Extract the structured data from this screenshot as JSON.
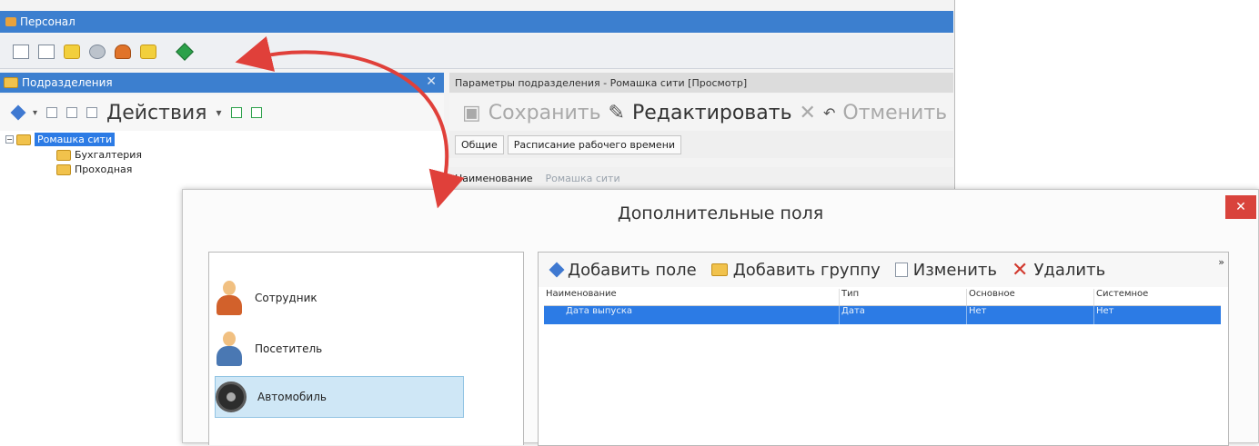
{
  "window": {
    "title": "Персонал"
  },
  "left_panel": {
    "title": "Подразделения",
    "actions_label": "Действия",
    "tree": [
      {
        "label": "Ромашка сити",
        "selected": true
      },
      {
        "label": "Бухгалтерия"
      },
      {
        "label": "Проходная"
      }
    ]
  },
  "params_panel": {
    "title": "Параметры подразделения - Ромашка сити [Просмотр]",
    "toolbar": {
      "save": "Сохранить",
      "edit": "Редактировать",
      "cancel": "Отменить"
    },
    "tabs": [
      "Общие",
      "Расписание рабочего времени"
    ],
    "name_label": "Наименование",
    "name_value": "Ромашка сити"
  },
  "dialog": {
    "title": "Дополнительные поля",
    "objects": [
      {
        "label": "Сотрудник",
        "icon": "employee-icon"
      },
      {
        "label": "Посетитель",
        "icon": "visitor-icon"
      },
      {
        "label": "Автомобиль",
        "icon": "car-wheel-icon",
        "selected": true
      }
    ],
    "toolbar": {
      "add_field": "Добавить поле",
      "add_group": "Добавить группу",
      "edit": "Изменить",
      "delete": "Удалить",
      "more": "»"
    },
    "grid": {
      "columns": [
        "Наименование",
        "Тип",
        "Основное",
        "Системное"
      ],
      "rows": [
        [
          "Дата выпуска",
          "Дата",
          "Нет",
          "Нет"
        ]
      ]
    }
  },
  "colors": {
    "accent": "#3c7fcf",
    "selection": "#2c7be5",
    "arrow": "#e0403a",
    "close": "#d9433c"
  }
}
